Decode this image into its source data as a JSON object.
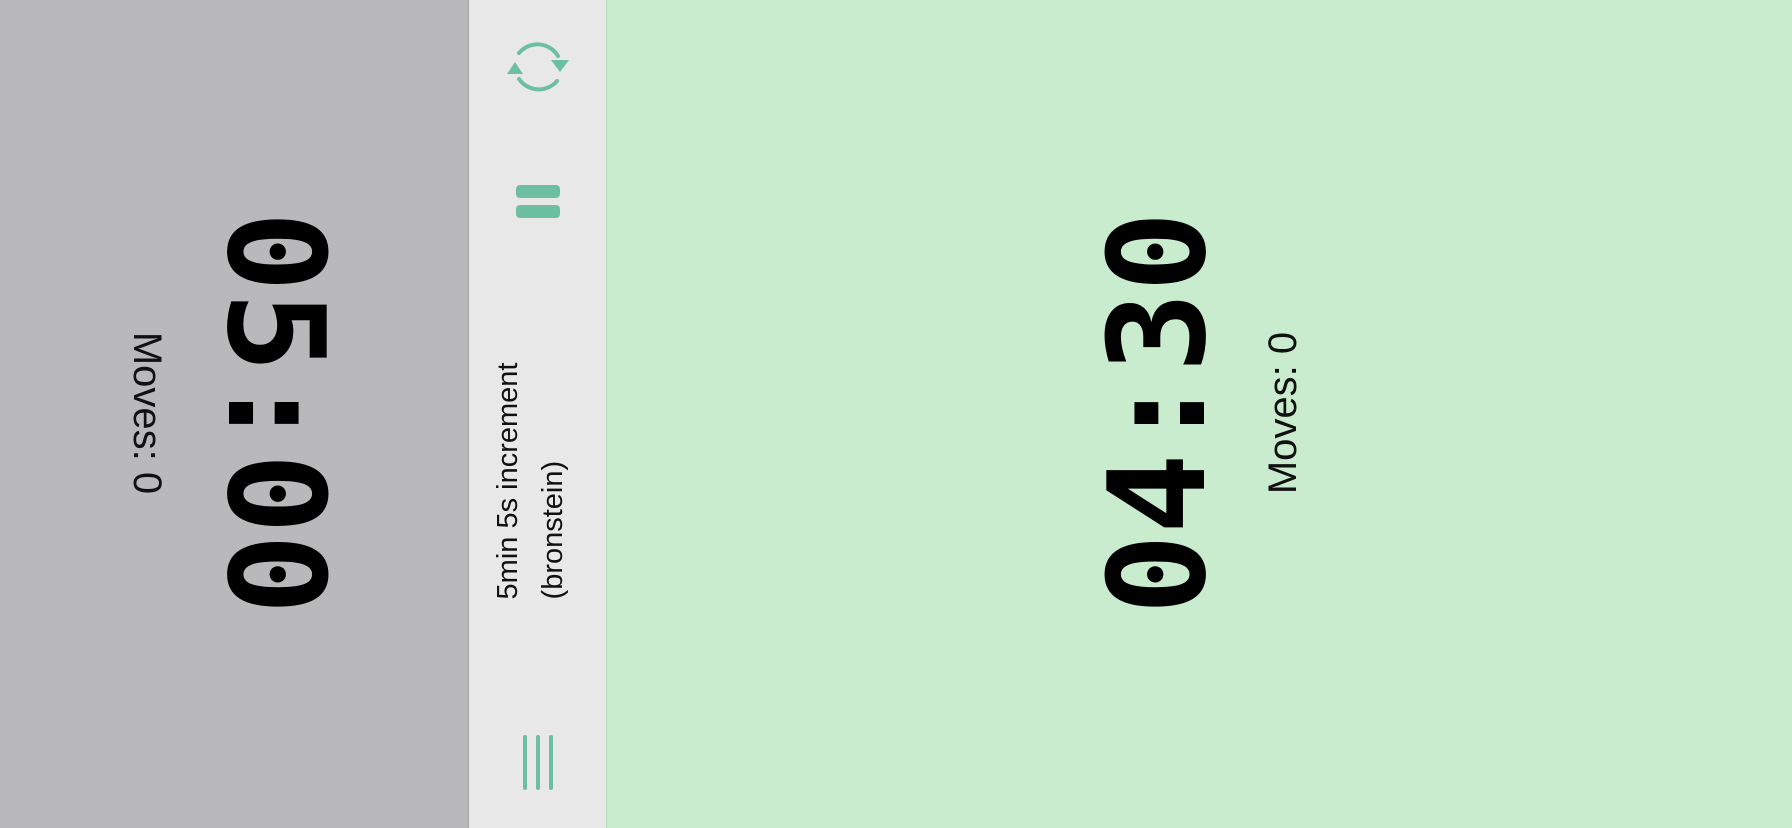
{
  "left_player": {
    "time": "05:00",
    "moves": "Moves: 0"
  },
  "right_player": {
    "time": "04:30",
    "moves": "Moves: 0"
  },
  "controls": {
    "mode_line1": "5min 5s increment",
    "mode_line2": "(bronstein)",
    "reset_icon": "reset-icon",
    "pause_icon": "pause-icon",
    "menu_icon": "menu-icon"
  },
  "colors": {
    "accent": "#6dbfa2",
    "inactive_clock": "#b9b9bb",
    "active_clock": "#c9eccf",
    "middle_bar": "#e8e8e8"
  }
}
